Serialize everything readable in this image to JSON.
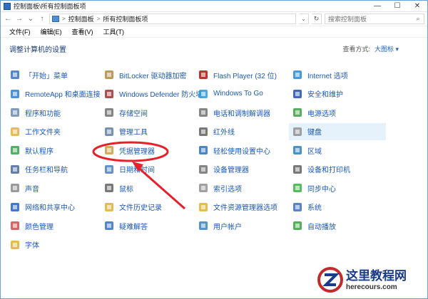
{
  "window": {
    "title": "控制面板\\所有控制面板项",
    "min": "—",
    "max": "☐",
    "close": "✕"
  },
  "address": {
    "parts": [
      "控制面板",
      "所有控制面板项"
    ],
    "sep": ">",
    "search_placeholder": "搜索控制面板"
  },
  "menu": [
    "文件(F)",
    "编辑(E)",
    "查看(V)",
    "工具(T)"
  ],
  "header": {
    "title": "调整计算机的设置",
    "viewby_label": "查看方式:",
    "viewby_value": "大图标 ▾"
  },
  "columns": [
    [
      {
        "label": "「开始」菜单",
        "icon": "start-menu-icon"
      },
      {
        "label": "RemoteApp 和桌面连接",
        "icon": "remoteapp-icon"
      },
      {
        "label": "程序和功能",
        "icon": "programs-icon"
      },
      {
        "label": "工作文件夹",
        "icon": "work-folders-icon"
      },
      {
        "label": "默认程序",
        "icon": "default-programs-icon"
      },
      {
        "label": "任务栏和导航",
        "icon": "taskbar-icon"
      },
      {
        "label": "声音",
        "icon": "sound-icon"
      },
      {
        "label": "网络和共享中心",
        "icon": "network-icon"
      },
      {
        "label": "颜色管理",
        "icon": "color-management-icon"
      },
      {
        "label": "字体",
        "icon": "fonts-icon"
      }
    ],
    [
      {
        "label": "BitLocker 驱动器加密",
        "icon": "bitlocker-icon"
      },
      {
        "label": "Windows Defender 防火墙",
        "icon": "firewall-icon"
      },
      {
        "label": "存储空间",
        "icon": "storage-icon"
      },
      {
        "label": "管理工具",
        "icon": "admin-tools-icon"
      },
      {
        "label": "凭据管理器",
        "icon": "credential-icon"
      },
      {
        "label": "日期和时间",
        "icon": "datetime-icon"
      },
      {
        "label": "鼠标",
        "icon": "mouse-icon"
      },
      {
        "label": "文件历史记录",
        "icon": "file-history-icon"
      },
      {
        "label": "疑难解答",
        "icon": "troubleshoot-icon"
      }
    ],
    [
      {
        "label": "Flash Player (32 位)",
        "icon": "flash-icon"
      },
      {
        "label": "Windows To Go",
        "icon": "windows-to-go-icon"
      },
      {
        "label": "电话和调制解调器",
        "icon": "phone-modem-icon"
      },
      {
        "label": "红外线",
        "icon": "infrared-icon"
      },
      {
        "label": "轻松使用设置中心",
        "icon": "ease-of-access-icon"
      },
      {
        "label": "设备管理器",
        "icon": "device-manager-icon"
      },
      {
        "label": "索引选项",
        "icon": "indexing-icon"
      },
      {
        "label": "文件资源管理器选项",
        "icon": "explorer-options-icon"
      },
      {
        "label": "用户帐户",
        "icon": "user-accounts-icon"
      }
    ],
    [
      {
        "label": "Internet 选项",
        "icon": "internet-options-icon"
      },
      {
        "label": "安全和维护",
        "icon": "security-maintenance-icon"
      },
      {
        "label": "电源选项",
        "icon": "power-options-icon"
      },
      {
        "label": "键盘",
        "icon": "keyboard-icon"
      },
      {
        "label": "区域",
        "icon": "region-icon"
      },
      {
        "label": "设备和打印机",
        "icon": "devices-printers-icon"
      },
      {
        "label": "同步中心",
        "icon": "sync-center-icon"
      },
      {
        "label": "系统",
        "icon": "system-icon"
      },
      {
        "label": "自动播放",
        "icon": "autoplay-icon"
      }
    ]
  ],
  "watermark": {
    "cn": "这里教程网",
    "url": "herecours.com"
  },
  "colors": {
    "link": "#1c58b8",
    "annotation": "#e8202a",
    "highlight": "#e5f1fb"
  }
}
